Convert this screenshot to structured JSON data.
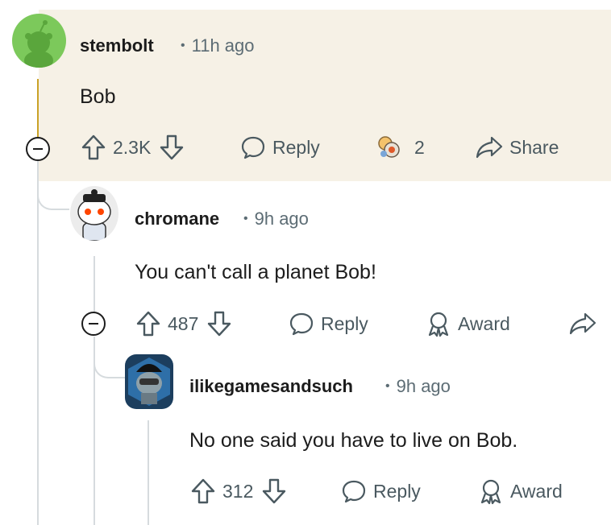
{
  "comments": [
    {
      "username": "stembolt",
      "time": "11h ago",
      "body": "Bob",
      "score": "2.3K",
      "reply_label": "Reply",
      "award_count": "2",
      "share_label": "Share"
    },
    {
      "username": "chromane",
      "time": "9h ago",
      "body": "You can't call a planet Bob!",
      "score": "487",
      "reply_label": "Reply",
      "award_label": "Award"
    },
    {
      "username": "ilikegamesandsuch",
      "time": "9h ago",
      "body": "No one said you have to live on Bob.",
      "score": "312",
      "reply_label": "Reply",
      "award_label": "Award"
    }
  ],
  "colors": {
    "highlight_bg": "#f6f1e6",
    "thread_line_active": "#c9a227",
    "thread_line": "#d6dbde",
    "meta_text": "#5c6c74",
    "avatar_green": "#7cc95b"
  },
  "icons": [
    "upvote-icon",
    "downvote-icon",
    "reply-icon",
    "award-icon",
    "share-icon",
    "collapse-icon"
  ]
}
